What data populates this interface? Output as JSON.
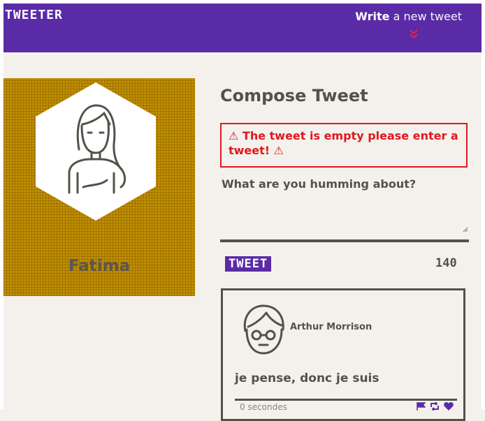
{
  "nav": {
    "brand": "TWEETER",
    "write_bold": "Write",
    "write_rest": "a new tweet",
    "chevron": "»"
  },
  "profile": {
    "name": "Fatima",
    "avatar_icon": "female-avatar-icon"
  },
  "compose": {
    "title": "Compose Tweet",
    "error": "⚠ The tweet is empty please enter a tweet! ⚠",
    "placeholder": "What are you humming about?",
    "button_label": "TWEET",
    "counter": "140"
  },
  "tweet": {
    "author": "Arthur Morrison",
    "text": "je pense, donc je suis",
    "time": "0 secondes",
    "actions": [
      "flag-icon",
      "retweet-icon",
      "heart-icon"
    ]
  },
  "colors": {
    "nav": "#5a2ba7",
    "error": "#e0171f",
    "profile_bg": "#c08f00",
    "page_bg": "#f4f1ec",
    "text": "#545149"
  }
}
